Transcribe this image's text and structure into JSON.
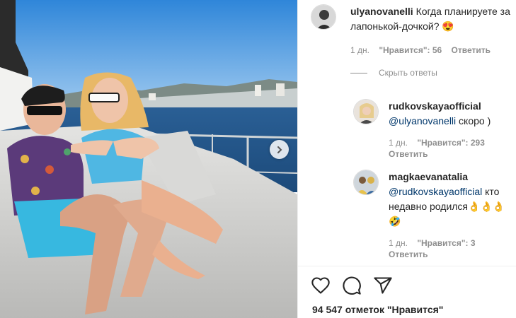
{
  "comments": [
    {
      "username": "ulyanovanelli",
      "text": "Когда планируете за лапонькой-дочкой? 😍",
      "time": "1 дн.",
      "likes": "\"Нравится\": 56",
      "reply": "Ответить"
    }
  ],
  "hide_replies": "Скрыть ответы",
  "replies": [
    {
      "username": "rudkovskayaofficial",
      "mention": "@ulyanovanelli",
      "text": " скоро )",
      "time": "1 дн.",
      "likes": "\"Нравится\": 293",
      "reply": "Ответить"
    },
    {
      "username": "magkaevanatalia",
      "mention": "@rudkovskayaofficial",
      "text": " кто недавно родился👌👌👌🤣",
      "time": "1 дн.",
      "likes": "\"Нравится\": 3",
      "reply": "Ответить"
    }
  ],
  "post": {
    "likes_count": "94 547 отметок \"Нравится\""
  },
  "icons": {
    "like": "heart-icon",
    "comment": "comment-icon",
    "share": "share-icon",
    "next": "chevron-right-icon"
  }
}
